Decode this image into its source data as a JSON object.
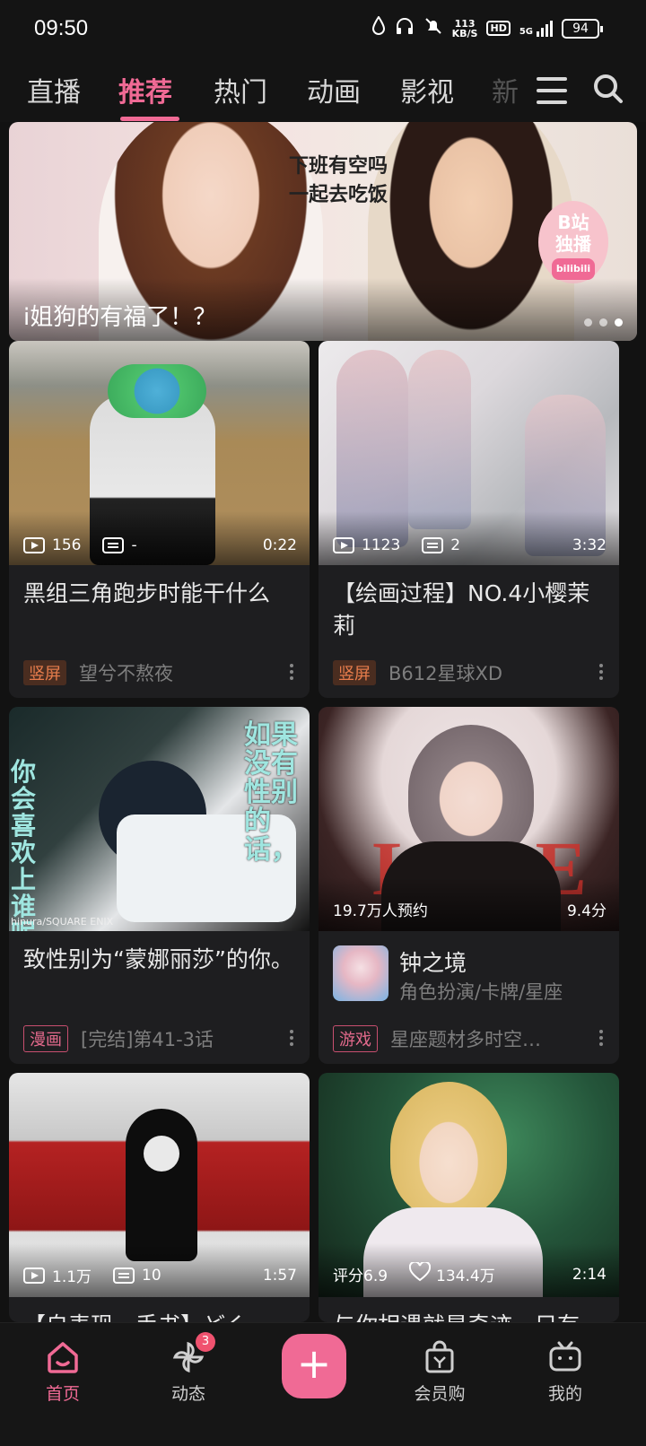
{
  "status_bar": {
    "time": "09:50",
    "network_speed_value": "113",
    "network_speed_unit": "KB/S",
    "hd_label": "HD",
    "network_type": "5G",
    "battery": "94"
  },
  "tabs": {
    "items": [
      "直播",
      "推荐",
      "热门",
      "动画",
      "影视"
    ],
    "partial": "新",
    "active": "推荐"
  },
  "banner": {
    "speech": "下班有空吗\n一起去吃饭",
    "badge_line1": "B站",
    "badge_line2": "独播",
    "badge_small": "bilibili",
    "caption": "i姐狗的有福了！？"
  },
  "cards": [
    {
      "views": "156",
      "danmaku": "-",
      "duration": "0:22",
      "title": "黑组三角跑步时能干什么",
      "tag": "竖屏",
      "author": "望兮不熬夜"
    },
    {
      "views": "1123",
      "danmaku": "2",
      "duration": "3:32",
      "title": "【绘画过程】NO.4小樱茉莉",
      "tag": "竖屏",
      "author": "B612星球XD"
    },
    {
      "overlay_text_1": "如果没有性别的话，",
      "overlay_text_2": "你会喜欢上谁呢",
      "credit": "hinura/SQUARE ENIX",
      "title": "致性别为“蒙娜丽莎”的你。",
      "tag": "漫画",
      "author": "[完结]第41-3话"
    },
    {
      "reservations": "19.7万人预约",
      "score": "9.4分",
      "game_name": "钟之境",
      "game_genre": "角色扮演/卡牌/星座",
      "tag": "游戏",
      "author": "星座题材多时空…"
    },
    {
      "views": "1.1万",
      "danmaku": "10",
      "duration": "1:57",
      "title": "【自表现、手书】どく"
    },
    {
      "rating": "评分6.9",
      "likes": "134.4万",
      "duration": "2:14",
      "title": "与你相遇就是奇迹，只有"
    }
  ],
  "bottom_nav": {
    "home": "首页",
    "dynamic": "动态",
    "dynamic_badge": "3",
    "publish": "+",
    "shop": "会员购",
    "mine": "我的"
  },
  "colors": {
    "accent": "#f06a95",
    "background": "#121212",
    "card": "#1e1e20"
  }
}
